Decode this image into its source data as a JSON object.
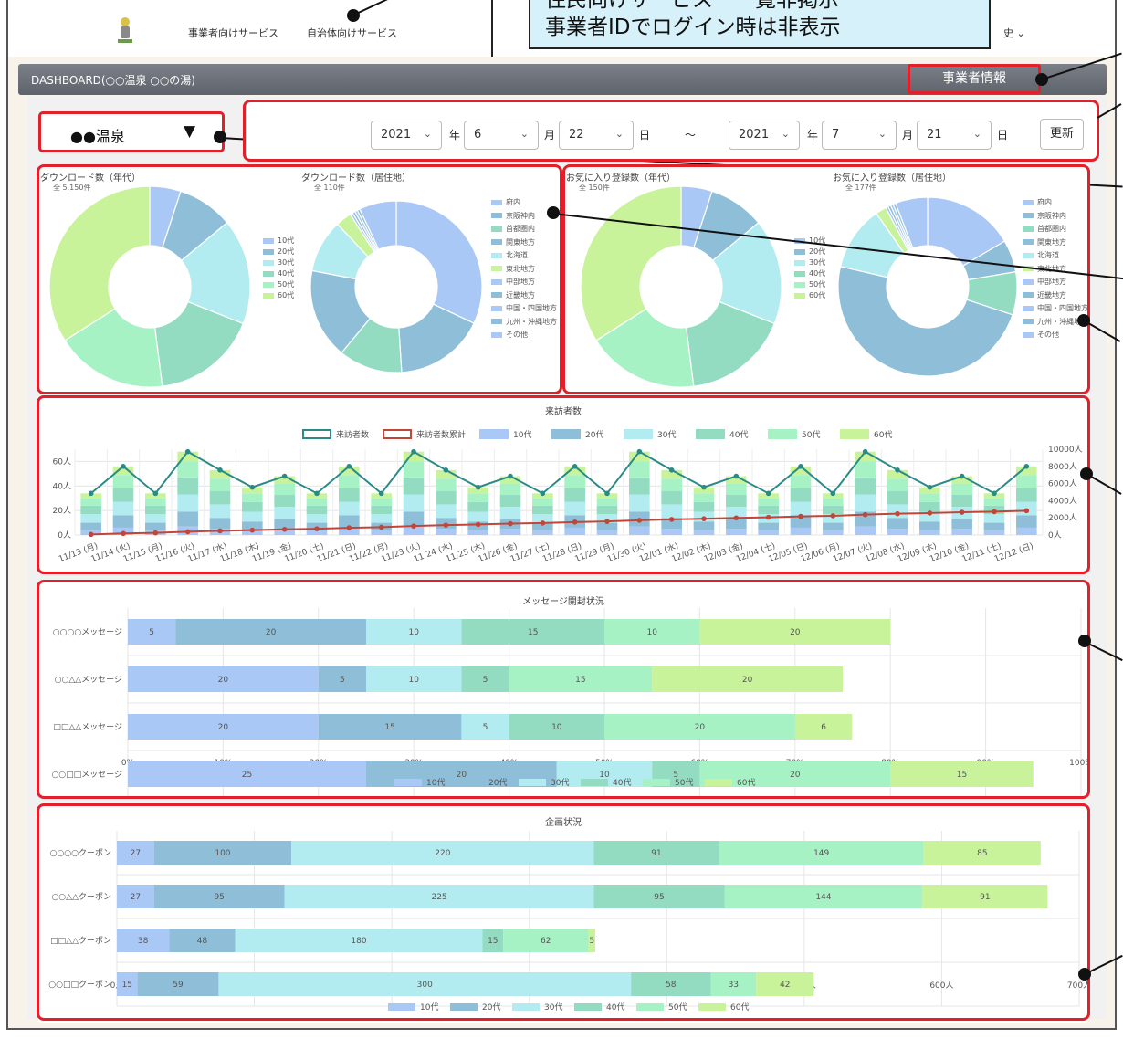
{
  "nav": {
    "link_business": "事業者向けサービス",
    "link_municipal": "自治体向けサービス",
    "history": "史 ⌄"
  },
  "callout": {
    "line1": "住民向けサービス　一覧非掲示",
    "line2": "事業者IDでログイン時は非表示"
  },
  "header": {
    "title": "DASHBOARD(○○温泉 ○○の湯)",
    "business_info": "事業者情報"
  },
  "facility_select": {
    "label": "●●温泉",
    "arrow": "▼"
  },
  "date_range": {
    "from": {
      "year": "2021",
      "month": "6",
      "day": "22"
    },
    "to": {
      "year": "2021",
      "month": "7",
      "day": "21"
    },
    "year_unit": "年",
    "month_unit": "月",
    "day_unit": "日",
    "separator": "〜",
    "update_button": "更新"
  },
  "colors": {
    "c10": "#a9c8f5",
    "c20": "#8fbfd8",
    "c30": "#b3ecf0",
    "c40": "#93dcc2",
    "c50": "#a6f2c5",
    "c60": "#c9f39b",
    "visitors_line": "#2a8a86",
    "cumulative_line": "#c0463a",
    "highlight": "#e0202a"
  },
  "legend_age": [
    "10代",
    "20代",
    "30代",
    "40代",
    "50代",
    "60代"
  ],
  "legend_region": [
    "府内",
    "京阪神内",
    "首都圏内",
    "関東地方",
    "北海道",
    "東北地方",
    "中部地方",
    "近畿地方",
    "中国・四国地方",
    "九州・沖縄地方",
    "その他"
  ],
  "chart_data": [
    {
      "type": "pie",
      "title": "ダウンロード数（年代）",
      "subtitle": "全 5,150件",
      "categories": [
        "10代",
        "20代",
        "30代",
        "40代",
        "50代",
        "60代"
      ],
      "values": [
        5,
        9,
        17,
        17,
        18,
        34
      ]
    },
    {
      "type": "pie",
      "title": "ダウンロード数（居住地）",
      "subtitle": "全 110件",
      "categories": [
        "府内",
        "京阪神内",
        "首都圏内",
        "関東地方",
        "北海道",
        "東北地方",
        "中部地方",
        "近畿地方",
        "中国・四国地方",
        "九州・沖縄地方",
        "その他"
      ],
      "values": [
        32,
        17,
        12,
        17,
        10,
        3,
        0.5,
        0.5,
        0.5,
        0.5,
        7
      ]
    },
    {
      "type": "pie",
      "title": "お気に入り登録数（年代）",
      "subtitle": "全 150件",
      "categories": [
        "10代",
        "20代",
        "30代",
        "40代",
        "50代",
        "60代"
      ],
      "values": [
        5,
        9,
        17,
        17,
        18,
        34
      ]
    },
    {
      "type": "pie",
      "title": "お気に入り登録数（居住地）",
      "subtitle": "全 177件",
      "categories": [
        "府内",
        "京阪神内",
        "首都圏内",
        "関東地方",
        "北海道",
        "東北地方",
        "中部地方",
        "近畿地方",
        "中国・四国地方",
        "九州・沖縄地方",
        "その他"
      ],
      "values": [
        17,
        6,
        8,
        50,
        12,
        2,
        0.5,
        0.5,
        0.5,
        0.5,
        6
      ]
    },
    {
      "type": "bar",
      "title": "来訪者数",
      "categories": [
        "11/13 (月)",
        "11/14 (火)",
        "11/15 (月)",
        "11/16 (火)",
        "11/17 (水)",
        "11/18 (木)",
        "11/19 (金)",
        "11/20 (土)",
        "11/21 (日)",
        "11/22 (月)",
        "11/23 (火)",
        "11/24 (水)",
        "11/25 (木)",
        "11/26 (金)",
        "11/27 (土)",
        "11/28 (日)",
        "11/29 (月)",
        "11/30 (火)",
        "12/01 (水)",
        "12/02 (木)",
        "12/03 (金)",
        "12/04 (土)",
        "12/05 (日)",
        "12/06 (月)",
        "12/07 (火)",
        "12/08 (水)",
        "12/09 (木)",
        "12/10 (金)",
        "12/11 (土)",
        "12/12 (日)"
      ],
      "series": [
        {
          "name": "来訪者数",
          "values": [
            34,
            56,
            34,
            68,
            53,
            39,
            48,
            34,
            56,
            34,
            68,
            53,
            39,
            48,
            34,
            56,
            34,
            68,
            53,
            39,
            48,
            34,
            56,
            34,
            68,
            53,
            39,
            48,
            34,
            56
          ]
        },
        {
          "name": "来訪者数累計",
          "values": [
            34,
            90,
            124,
            192,
            245,
            284,
            332,
            366,
            422,
            456,
            524,
            577,
            616,
            664,
            698,
            754,
            788,
            856,
            909,
            948,
            996,
            1030,
            1086,
            1120,
            1188,
            1241,
            1280,
            1328,
            1362,
            1418
          ]
        },
        {
          "name": "10代",
          "values": [
            4,
            6,
            4,
            7,
            5,
            4,
            5,
            4,
            6,
            4,
            7,
            5,
            4,
            5,
            4,
            6,
            4,
            7,
            5,
            4,
            5,
            4,
            6,
            4,
            7,
            5,
            4,
            5,
            4,
            6
          ]
        },
        {
          "name": "20代",
          "values": [
            6,
            10,
            6,
            12,
            9,
            7,
            8,
            6,
            10,
            6,
            12,
            9,
            7,
            8,
            6,
            10,
            6,
            12,
            9,
            7,
            8,
            6,
            10,
            6,
            12,
            9,
            7,
            8,
            6,
            10
          ]
        },
        {
          "name": "30代",
          "values": [
            7,
            11,
            7,
            14,
            11,
            8,
            10,
            7,
            11,
            7,
            14,
            11,
            8,
            10,
            7,
            11,
            7,
            14,
            11,
            8,
            10,
            7,
            11,
            7,
            14,
            11,
            8,
            10,
            7,
            11
          ]
        },
        {
          "name": "40代",
          "values": [
            7,
            11,
            7,
            14,
            11,
            8,
            10,
            7,
            11,
            7,
            14,
            11,
            8,
            10,
            7,
            11,
            7,
            14,
            11,
            8,
            10,
            7,
            11,
            7,
            14,
            11,
            8,
            10,
            7,
            11
          ]
        },
        {
          "name": "50代",
          "values": [
            6,
            11,
            6,
            13,
            10,
            7,
            9,
            6,
            11,
            6,
            13,
            10,
            7,
            9,
            6,
            11,
            6,
            13,
            10,
            7,
            9,
            6,
            11,
            6,
            13,
            10,
            7,
            9,
            6,
            11
          ]
        },
        {
          "name": "60代",
          "values": [
            4,
            7,
            4,
            8,
            7,
            5,
            6,
            4,
            7,
            4,
            8,
            7,
            5,
            6,
            4,
            7,
            4,
            8,
            7,
            5,
            6,
            4,
            7,
            4,
            8,
            7,
            5,
            6,
            4,
            7
          ]
        }
      ],
      "y_left_ticks": [
        "0人",
        "20人",
        "40人",
        "60人"
      ],
      "y_right_ticks": [
        "0人",
        "2000人",
        "4000人",
        "6000人",
        "8000人",
        "10000人"
      ],
      "ylim_left": [
        0,
        70
      ],
      "ylim_right": [
        0,
        10000
      ]
    },
    {
      "type": "bar",
      "title": "メッセージ開封状況",
      "categories": [
        "○○○○メッセージ",
        "○○△△メッセージ",
        "□□△△メッセージ",
        "○○□□メッセージ"
      ],
      "series": [
        {
          "name": "10代",
          "values": [
            5,
            20,
            20,
            25
          ]
        },
        {
          "name": "20代",
          "values": [
            20,
            5,
            15,
            20
          ]
        },
        {
          "name": "30代",
          "values": [
            10,
            10,
            5,
            10
          ]
        },
        {
          "name": "40代",
          "values": [
            15,
            5,
            10,
            5
          ]
        },
        {
          "name": "50代",
          "values": [
            10,
            15,
            20,
            20
          ]
        },
        {
          "name": "60代",
          "values": [
            20,
            20,
            6,
            15
          ]
        }
      ],
      "x_ticks": [
        "0%",
        "10%",
        "20%",
        "30%",
        "40%",
        "50%",
        "60%",
        "70%",
        "80%",
        "90%",
        "100%"
      ],
      "xlim": [
        0,
        100
      ]
    },
    {
      "type": "bar",
      "title": "企画状況",
      "categories": [
        "○○○○クーポン",
        "○○△△クーポン",
        "□□△△クーポン",
        "○○□□クーポン"
      ],
      "series": [
        {
          "name": "10代",
          "values": [
            27,
            27,
            38,
            15
          ]
        },
        {
          "name": "20代",
          "values": [
            100,
            95,
            48,
            59
          ]
        },
        {
          "name": "30代",
          "values": [
            220,
            225,
            180,
            300
          ]
        },
        {
          "name": "40代",
          "values": [
            91,
            95,
            15,
            58
          ]
        },
        {
          "name": "50代",
          "values": [
            149,
            144,
            62,
            33
          ]
        },
        {
          "name": "60代",
          "values": [
            85,
            91,
            5,
            42
          ]
        }
      ],
      "x_ticks": [
        "0人",
        "100人",
        "200人",
        "300人",
        "400人",
        "500人",
        "600人",
        "700人"
      ],
      "xlim": [
        0,
        700
      ]
    }
  ]
}
